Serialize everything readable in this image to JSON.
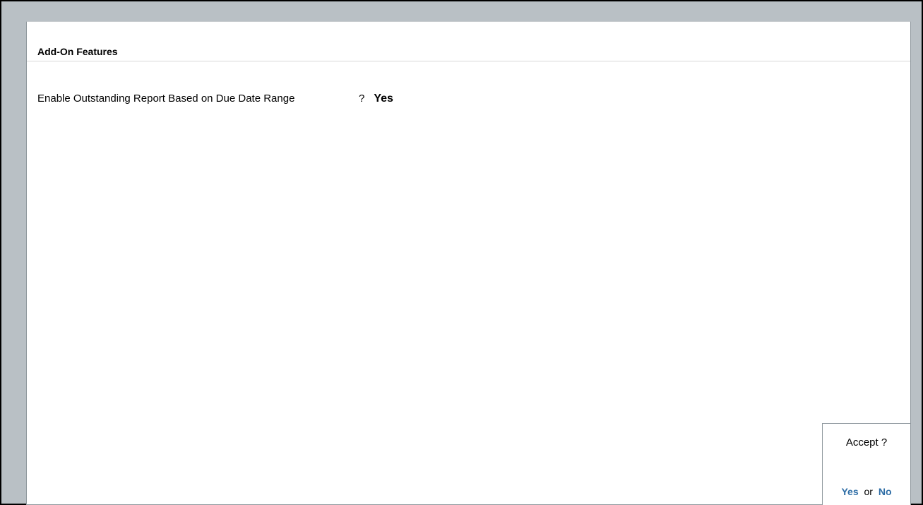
{
  "header": {
    "title": "Add-On Features"
  },
  "feature": {
    "label": "Enable Outstanding Report Based on Due Date Range",
    "question_mark": "?",
    "value": "Yes"
  },
  "accept": {
    "question": "Accept ?",
    "yes_label": "Yes",
    "or_label": "or",
    "no_label": "No"
  },
  "colors": {
    "outer_background": "#b9c0c5",
    "panel_background": "#ffffff",
    "accent_blue": "#2f6ea6"
  }
}
